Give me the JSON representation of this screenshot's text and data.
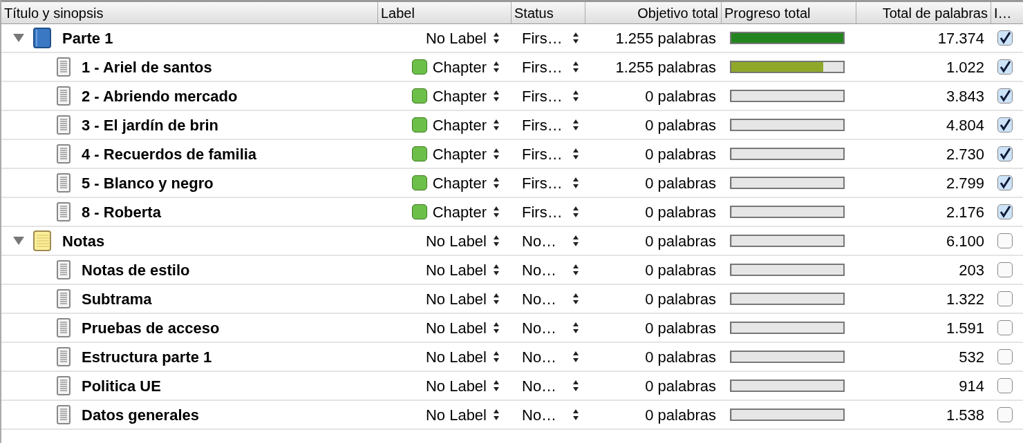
{
  "columns": [
    "Título y sinopsis",
    "Label",
    "Status",
    "Objetivo total",
    "Progreso total",
    "Total de palabras",
    "I…"
  ],
  "rows": [
    {
      "kind": "book",
      "title": "Parte 1",
      "expanded": true,
      "label": "No Label",
      "status": "Firs…",
      "target": "1.255 palabras",
      "level": 1,
      "total": "17.374",
      "checked": true,
      "children": [
        {
          "kind": "document",
          "title": "1 - Ariel de santos",
          "label": "Chapter",
          "color": "#6cc04a",
          "status": "Firs…",
          "target": "1.255 palabras",
          "level": 0.82,
          "total": "1.022",
          "checked": true
        },
        {
          "kind": "document",
          "title": "2 - Abriendo mercado",
          "label": "Chapter",
          "color": "#6cc04a",
          "status": "Firs…",
          "target": "0 palabras",
          "level": 0,
          "total": "3.843",
          "checked": true
        },
        {
          "kind": "document",
          "title": "3 - El jardín de brin",
          "label": "Chapter",
          "color": "#6cc04a",
          "status": "Firs…",
          "target": "0 palabras",
          "level": 0,
          "total": "4.804",
          "checked": true
        },
        {
          "kind": "document",
          "title": "4 - Recuerdos de familia",
          "label": "Chapter",
          "color": "#6cc04a",
          "status": "Firs…",
          "target": "0 palabras",
          "level": 0,
          "total": "2.730",
          "checked": true
        },
        {
          "kind": "document",
          "title": "5 - Blanco y negro",
          "label": "Chapter",
          "color": "#6cc04a",
          "status": "Firs…",
          "target": "0 palabras",
          "level": 0,
          "total": "2.799",
          "checked": true
        },
        {
          "kind": "document",
          "title": "8 - Roberta",
          "label": "Chapter",
          "color": "#6cc04a",
          "status": "Firs…",
          "target": "0 palabras",
          "level": 0,
          "total": "2.176",
          "checked": true
        }
      ]
    },
    {
      "kind": "notebook",
      "title": "Notas",
      "expanded": true,
      "label": "No Label",
      "status": "No…",
      "target": "0 palabras",
      "level": 0,
      "total": "6.100",
      "checked": false,
      "children": [
        {
          "kind": "document",
          "title": "Notas de estilo",
          "label": "No Label",
          "status": "No…",
          "target": "0 palabras",
          "level": 0,
          "total": "203",
          "checked": false
        },
        {
          "kind": "document",
          "title": "Subtrama",
          "label": "No Label",
          "status": "No…",
          "target": "0 palabras",
          "level": 0,
          "total": "1.322",
          "checked": false
        },
        {
          "kind": "document",
          "title": "Pruebas de acceso",
          "label": "No Label",
          "status": "No…",
          "target": "0 palabras",
          "level": 0,
          "total": "1.591",
          "checked": false
        },
        {
          "kind": "document",
          "title": "Estructura parte 1",
          "label": "No Label",
          "status": "No…",
          "target": "0 palabras",
          "level": 0,
          "total": "532",
          "checked": false
        },
        {
          "kind": "document",
          "title": "Politica UE",
          "label": "No Label",
          "status": "No…",
          "target": "0 palabras",
          "level": 0,
          "total": "914",
          "checked": false
        },
        {
          "kind": "document",
          "title": "Datos generales",
          "label": "No Label",
          "status": "No…",
          "target": "0 palabras",
          "level": 0,
          "total": "1.538",
          "checked": false
        }
      ]
    }
  ]
}
